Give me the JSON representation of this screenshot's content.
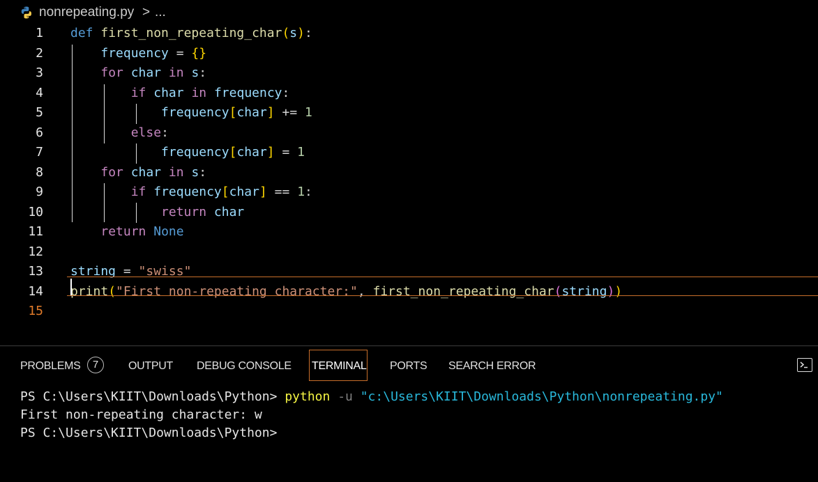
{
  "breadcrumb": {
    "file_icon": "python-icon",
    "file": "nonrepeating.py",
    "separator": ">",
    "more": "..."
  },
  "editor": {
    "line_numbers": [
      "1",
      "2",
      "3",
      "4",
      "5",
      "6",
      "7",
      "8",
      "9",
      "10",
      "11",
      "12",
      "13",
      "14",
      "15"
    ],
    "active_line": "15",
    "lines": [
      [
        [
          "kw",
          "def"
        ],
        [
          "op",
          " "
        ],
        [
          "fn",
          "first_non_repeating_char"
        ],
        [
          "br1",
          "("
        ],
        [
          "var",
          "s"
        ],
        [
          "br1",
          ")"
        ],
        [
          "op",
          ":"
        ]
      ],
      [
        [
          "op",
          "    "
        ],
        [
          "var",
          "frequency"
        ],
        [
          "op",
          " = "
        ],
        [
          "br1",
          "{}"
        ]
      ],
      [
        [
          "op",
          "    "
        ],
        [
          "kw2",
          "for"
        ],
        [
          "op",
          " "
        ],
        [
          "var",
          "char"
        ],
        [
          "op",
          " "
        ],
        [
          "kw2",
          "in"
        ],
        [
          "op",
          " "
        ],
        [
          "var",
          "s"
        ],
        [
          "op",
          ":"
        ]
      ],
      [
        [
          "op",
          "        "
        ],
        [
          "kw2",
          "if"
        ],
        [
          "op",
          " "
        ],
        [
          "var",
          "char"
        ],
        [
          "op",
          " "
        ],
        [
          "kw2",
          "in"
        ],
        [
          "op",
          " "
        ],
        [
          "var",
          "frequency"
        ],
        [
          "op",
          ":"
        ]
      ],
      [
        [
          "op",
          "            "
        ],
        [
          "var",
          "frequency"
        ],
        [
          "br1",
          "["
        ],
        [
          "var",
          "char"
        ],
        [
          "br1",
          "]"
        ],
        [
          "op",
          " += "
        ],
        [
          "num",
          "1"
        ]
      ],
      [
        [
          "op",
          "        "
        ],
        [
          "kw2",
          "else"
        ],
        [
          "op",
          ":"
        ]
      ],
      [
        [
          "op",
          "            "
        ],
        [
          "var",
          "frequency"
        ],
        [
          "br1",
          "["
        ],
        [
          "var",
          "char"
        ],
        [
          "br1",
          "]"
        ],
        [
          "op",
          " = "
        ],
        [
          "num",
          "1"
        ]
      ],
      [
        [
          "op",
          "    "
        ],
        [
          "kw2",
          "for"
        ],
        [
          "op",
          " "
        ],
        [
          "var",
          "char"
        ],
        [
          "op",
          " "
        ],
        [
          "kw2",
          "in"
        ],
        [
          "op",
          " "
        ],
        [
          "var",
          "s"
        ],
        [
          "op",
          ":"
        ]
      ],
      [
        [
          "op",
          "        "
        ],
        [
          "kw2",
          "if"
        ],
        [
          "op",
          " "
        ],
        [
          "var",
          "frequency"
        ],
        [
          "br1",
          "["
        ],
        [
          "var",
          "char"
        ],
        [
          "br1",
          "]"
        ],
        [
          "op",
          " == "
        ],
        [
          "num",
          "1"
        ],
        [
          "op",
          ":"
        ]
      ],
      [
        [
          "op",
          "            "
        ],
        [
          "kw2",
          "return"
        ],
        [
          "op",
          " "
        ],
        [
          "var",
          "char"
        ]
      ],
      [
        [
          "op",
          "    "
        ],
        [
          "kw2",
          "return"
        ],
        [
          "op",
          " "
        ],
        [
          "kw",
          "None"
        ]
      ],
      [],
      [
        [
          "var",
          "string"
        ],
        [
          "op",
          " = "
        ],
        [
          "str",
          "\"swiss\""
        ]
      ],
      [
        [
          "fn",
          "print"
        ],
        [
          "br1",
          "("
        ],
        [
          "str",
          "\"First non-repeating character:\""
        ],
        [
          "op",
          ", "
        ],
        [
          "fn",
          "first_non_repeating_char"
        ],
        [
          "br2",
          "("
        ],
        [
          "var",
          "string"
        ],
        [
          "br2",
          ")"
        ],
        [
          "br1",
          ")"
        ]
      ],
      []
    ]
  },
  "panel": {
    "tabs": [
      {
        "label": "PROBLEMS",
        "name": "tab-problems"
      },
      {
        "label": "OUTPUT",
        "name": "tab-output"
      },
      {
        "label": "DEBUG CONSOLE",
        "name": "tab-debug-console"
      },
      {
        "label": "TERMINAL",
        "name": "tab-terminal"
      },
      {
        "label": "PORTS",
        "name": "tab-ports"
      },
      {
        "label": "SEARCH ERROR",
        "name": "tab-search-error"
      }
    ],
    "problems_count": "7",
    "active_tab": "TERMINAL",
    "terminal_icon": "terminal-icon"
  },
  "terminal": {
    "prompt": "PS C:\\Users\\KIIT\\Downloads\\Python>",
    "command": "python",
    "flag": "-u",
    "arg": "\"c:\\Users\\KIIT\\Downloads\\Python\\nonrepeating.py\"",
    "output": "First non-repeating character: w",
    "prompt2": "PS C:\\Users\\KIIT\\Downloads\\Python>"
  },
  "colors": {
    "accent": "#c96f2b",
    "background": "#000000"
  }
}
